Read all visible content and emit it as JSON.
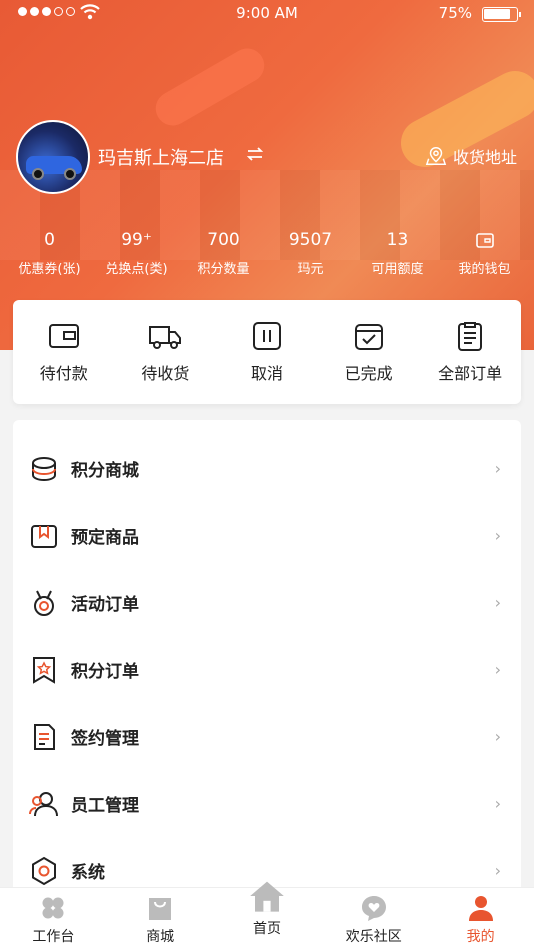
{
  "status_bar": {
    "time": "9:00 AM",
    "battery": "75%"
  },
  "header": {
    "store_name": "玛吉斯上海二店",
    "address_label": "收货地址"
  },
  "stats": [
    {
      "value": "0",
      "label": "优惠券(张)"
    },
    {
      "value": "99⁺",
      "label": "兑换点(类)"
    },
    {
      "value": "700",
      "label": "积分数量"
    },
    {
      "value": "9507",
      "label": "玛元"
    },
    {
      "value": "13",
      "label": "可用额度"
    },
    {
      "value": "",
      "label": "我的钱包",
      "icon": "wallet-icon"
    }
  ],
  "orders": [
    {
      "label": "待付款",
      "icon": "wallet-icon"
    },
    {
      "label": "待收货",
      "icon": "truck-icon"
    },
    {
      "label": "取消",
      "icon": "pause-icon"
    },
    {
      "label": "已完成",
      "icon": "check-box-icon"
    },
    {
      "label": "全部订单",
      "icon": "clipboard-icon"
    }
  ],
  "menu": [
    {
      "label": "积分商城",
      "icon": "coins-icon"
    },
    {
      "label": "预定商品",
      "icon": "gift-box-icon"
    },
    {
      "label": "活动订单",
      "icon": "medal-icon"
    },
    {
      "label": "积分订单",
      "icon": "star-bookmark-icon"
    },
    {
      "label": "签约管理",
      "icon": "document-icon"
    },
    {
      "label": "员工管理",
      "icon": "users-icon"
    },
    {
      "label": "系统",
      "icon": "settings-icon"
    }
  ],
  "tabbar": [
    {
      "label": "工作台",
      "icon": "workbench-icon",
      "active": false
    },
    {
      "label": "商城",
      "icon": "shopping-bag-icon",
      "active": false
    },
    {
      "label": "首页",
      "icon": "home-icon",
      "active": false
    },
    {
      "label": "欢乐社区",
      "icon": "community-icon",
      "active": false
    },
    {
      "label": "我的",
      "icon": "profile-icon",
      "active": true
    }
  ],
  "colors": {
    "accent": "#e8552f",
    "icon_gray": "#bbbbbb"
  }
}
